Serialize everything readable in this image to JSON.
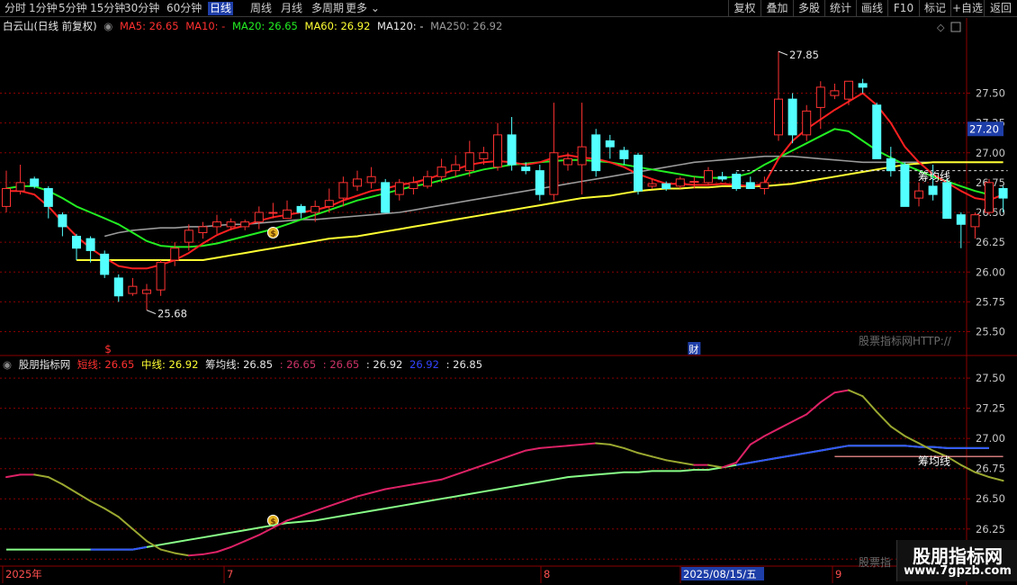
{
  "toolbar": {
    "periods": [
      "分时",
      "1分钟",
      "5分钟",
      "15分钟",
      "30分钟",
      "60分钟",
      "日线",
      "周线",
      "月线",
      "多周期",
      "更多"
    ],
    "active_period": "日线",
    "buttons": [
      "复权",
      "叠加",
      "多股",
      "统计",
      "画线",
      "F10",
      "标记",
      "+自选",
      "返回"
    ]
  },
  "main_legend": {
    "title": "白云山(日线 前复权)",
    "ma5": "MA5: 26.65",
    "ma10": "MA10: -",
    "ma20": "MA20: 26.65",
    "ma60": "MA60: 26.92",
    "ma120": "MA120: -",
    "ma250": "MA250: 26.92"
  },
  "sub_legend": {
    "title": "股朋指标网",
    "short": "短线: 26.65",
    "mid": "中线: 26.92",
    "chip": "筹均线: 26.85",
    "v1": ": 26.65",
    "v2": ": 26.65",
    "v3": ": 26.92",
    "v4": "26.92",
    "v5": ": 26.85"
  },
  "colors": {
    "up": "#ff3232",
    "down": "#54ffff",
    "ma5": "#ff2020",
    "ma20": "#22ee22",
    "ma60": "#ffff33",
    "ma250": "#9a9a9a",
    "grid": "#8b0000",
    "axis_label": "#c8c8c8"
  },
  "chart_data": [
    {
      "type": "candlestick",
      "title": "白云山(日线 前复权)",
      "ylim": [
        25.3,
        28.1
      ],
      "y_ticks": [
        25.5,
        25.75,
        26.0,
        26.25,
        26.5,
        26.75,
        27.0,
        27.25,
        27.5
      ],
      "current_price": "27.20",
      "annotations": {
        "high": "27.85",
        "low": "25.68",
        "chip_label": "筹均线",
        "marker_left": "$",
        "marker_right": "财"
      },
      "candles": [
        {
          "o": 26.55,
          "c": 26.7,
          "h": 26.85,
          "l": 26.5
        },
        {
          "o": 26.68,
          "c": 26.75,
          "h": 26.9,
          "l": 26.65
        },
        {
          "o": 26.78,
          "c": 26.72,
          "h": 26.8,
          "l": 26.7
        },
        {
          "o": 26.7,
          "c": 26.55,
          "h": 26.72,
          "l": 26.45
        },
        {
          "o": 26.48,
          "c": 26.38,
          "h": 26.5,
          "l": 26.3
        },
        {
          "o": 26.3,
          "c": 26.2,
          "h": 26.32,
          "l": 26.1
        },
        {
          "o": 26.28,
          "c": 26.18,
          "h": 26.3,
          "l": 26.08
        },
        {
          "o": 26.15,
          "c": 25.98,
          "h": 26.18,
          "l": 25.95
        },
        {
          "o": 25.95,
          "c": 25.8,
          "h": 25.98,
          "l": 25.75
        },
        {
          "o": 25.82,
          "c": 25.88,
          "h": 25.95,
          "l": 25.8
        },
        {
          "o": 25.82,
          "c": 25.85,
          "h": 25.9,
          "l": 25.68
        },
        {
          "o": 25.85,
          "c": 26.08,
          "h": 26.1,
          "l": 25.8
        },
        {
          "o": 26.1,
          "c": 26.2,
          "h": 26.25,
          "l": 26.05
        },
        {
          "o": 26.25,
          "c": 26.35,
          "h": 26.4,
          "l": 26.18
        },
        {
          "o": 26.33,
          "c": 26.38,
          "h": 26.42,
          "l": 26.28
        },
        {
          "o": 26.38,
          "c": 26.42,
          "h": 26.48,
          "l": 26.32
        },
        {
          "o": 26.38,
          "c": 26.42,
          "h": 26.45,
          "l": 26.35
        },
        {
          "o": 26.38,
          "c": 26.42,
          "h": 26.44,
          "l": 26.35
        },
        {
          "o": 26.42,
          "c": 26.5,
          "h": 26.55,
          "l": 26.36
        },
        {
          "o": 26.5,
          "c": 26.5,
          "h": 26.58,
          "l": 26.45
        },
        {
          "o": 26.45,
          "c": 26.52,
          "h": 26.6,
          "l": 26.45
        },
        {
          "o": 26.55,
          "c": 26.5,
          "h": 26.57,
          "l": 26.45
        },
        {
          "o": 26.5,
          "c": 26.55,
          "h": 26.6,
          "l": 26.42
        },
        {
          "o": 26.55,
          "c": 26.6,
          "h": 26.7,
          "l": 26.5
        },
        {
          "o": 26.62,
          "c": 26.75,
          "h": 26.8,
          "l": 26.55
        },
        {
          "o": 26.72,
          "c": 26.78,
          "h": 26.85,
          "l": 26.68
        },
        {
          "o": 26.75,
          "c": 26.8,
          "h": 26.88,
          "l": 26.7
        },
        {
          "o": 26.75,
          "c": 26.5,
          "h": 26.78,
          "l": 26.5
        },
        {
          "o": 26.65,
          "c": 26.75,
          "h": 26.78,
          "l": 26.6
        },
        {
          "o": 26.7,
          "c": 26.75,
          "h": 26.8,
          "l": 26.65
        },
        {
          "o": 26.72,
          "c": 26.8,
          "h": 26.85,
          "l": 26.7
        },
        {
          "o": 26.8,
          "c": 26.88,
          "h": 26.95,
          "l": 26.75
        },
        {
          "o": 26.85,
          "c": 26.9,
          "h": 26.98,
          "l": 26.8
        },
        {
          "o": 26.85,
          "c": 27.0,
          "h": 27.1,
          "l": 26.8
        },
        {
          "o": 26.95,
          "c": 27.0,
          "h": 27.05,
          "l": 26.9
        },
        {
          "o": 26.88,
          "c": 27.15,
          "h": 27.25,
          "l": 26.85
        },
        {
          "o": 27.15,
          "c": 26.9,
          "h": 27.3,
          "l": 26.85
        },
        {
          "o": 26.88,
          "c": 26.85,
          "h": 26.92,
          "l": 26.82
        },
        {
          "o": 26.85,
          "c": 26.65,
          "h": 26.9,
          "l": 26.6
        },
        {
          "o": 26.65,
          "c": 27.0,
          "h": 27.42,
          "l": 26.6
        },
        {
          "o": 26.9,
          "c": 26.95,
          "h": 27.0,
          "l": 26.85
        },
        {
          "o": 26.9,
          "c": 27.05,
          "h": 27.42,
          "l": 26.65
        },
        {
          "o": 27.15,
          "c": 26.85,
          "h": 27.2,
          "l": 26.8
        },
        {
          "o": 27.1,
          "c": 27.05,
          "h": 27.15,
          "l": 26.95
        },
        {
          "o": 27.02,
          "c": 26.95,
          "h": 27.05,
          "l": 26.9
        },
        {
          "o": 26.98,
          "c": 26.68,
          "h": 27.0,
          "l": 26.65
        },
        {
          "o": 26.72,
          "c": 26.74,
          "h": 26.78,
          "l": 26.7
        },
        {
          "o": 26.74,
          "c": 26.7,
          "h": 26.76,
          "l": 26.68
        },
        {
          "o": 26.72,
          "c": 26.78,
          "h": 26.8,
          "l": 26.7
        },
        {
          "o": 26.76,
          "c": 26.76,
          "h": 26.8,
          "l": 26.7
        },
        {
          "o": 26.75,
          "c": 26.85,
          "h": 26.88,
          "l": 26.73
        },
        {
          "o": 26.8,
          "c": 26.78,
          "h": 26.84,
          "l": 26.76
        },
        {
          "o": 26.82,
          "c": 26.7,
          "h": 26.84,
          "l": 26.68
        },
        {
          "o": 26.75,
          "c": 26.7,
          "h": 26.8,
          "l": 26.7
        },
        {
          "o": 26.7,
          "c": 26.75,
          "h": 26.8,
          "l": 26.65
        },
        {
          "o": 27.15,
          "c": 27.45,
          "h": 27.85,
          "l": 27.1
        },
        {
          "o": 27.45,
          "c": 27.15,
          "h": 27.5,
          "l": 27.08
        },
        {
          "o": 27.15,
          "c": 27.35,
          "h": 27.4,
          "l": 27.1
        },
        {
          "o": 27.38,
          "c": 27.55,
          "h": 27.6,
          "l": 27.2
        },
        {
          "o": 27.48,
          "c": 27.52,
          "h": 27.58,
          "l": 27.45
        },
        {
          "o": 27.45,
          "c": 27.6,
          "h": 27.6,
          "l": 27.4
        },
        {
          "o": 27.58,
          "c": 27.55,
          "h": 27.62,
          "l": 27.5
        },
        {
          "o": 27.4,
          "c": 26.95,
          "h": 27.42,
          "l": 26.95
        },
        {
          "o": 26.95,
          "c": 26.85,
          "h": 27.05,
          "l": 26.8
        },
        {
          "o": 26.9,
          "c": 26.55,
          "h": 26.92,
          "l": 26.55
        },
        {
          "o": 26.62,
          "c": 26.68,
          "h": 26.75,
          "l": 26.55
        },
        {
          "o": 26.72,
          "c": 26.65,
          "h": 26.9,
          "l": 26.6
        },
        {
          "o": 26.75,
          "c": 26.45,
          "h": 26.78,
          "l": 26.45
        },
        {
          "o": 26.48,
          "c": 26.4,
          "h": 26.5,
          "l": 26.2
        },
        {
          "o": 26.38,
          "c": 26.48,
          "h": 26.5,
          "l": 26.28
        },
        {
          "o": 26.5,
          "c": 26.75,
          "h": 26.78,
          "l": 26.48
        },
        {
          "o": 26.7,
          "c": 26.62,
          "h": 26.72,
          "l": 26.5
        }
      ],
      "ma5": [
        26.68,
        26.68,
        26.65,
        26.55,
        26.42,
        26.3,
        26.2,
        26.12,
        26.05,
        26.03,
        26.03,
        26.06,
        26.1,
        26.16,
        26.24,
        26.31,
        26.36,
        26.39,
        26.43,
        26.46,
        26.48,
        26.5,
        26.52,
        26.55,
        26.6,
        26.64,
        26.68,
        26.7,
        26.73,
        26.75,
        26.78,
        26.82,
        26.86,
        26.9,
        26.92,
        26.93,
        26.92,
        26.9,
        26.92,
        26.96,
        26.98,
        26.96,
        26.95,
        26.92,
        26.88,
        26.82,
        26.78,
        26.74,
        26.74,
        26.73,
        26.73,
        26.74,
        26.73,
        26.72,
        26.74,
        26.95,
        27.1,
        27.2,
        27.28,
        27.36,
        27.43,
        27.5,
        27.4,
        27.25,
        27.05,
        26.92,
        26.82,
        26.75,
        26.68,
        26.62,
        26.6,
        26.65
      ],
      "ma20": [
        26.7,
        26.72,
        26.72,
        26.68,
        26.62,
        26.55,
        26.5,
        26.45,
        26.4,
        26.33,
        26.26,
        26.22,
        26.21,
        26.21,
        26.22,
        26.24,
        26.27,
        26.3,
        26.33,
        26.36,
        26.4,
        26.44,
        26.48,
        26.52,
        26.56,
        26.6,
        26.63,
        26.66,
        26.69,
        26.72,
        26.74,
        26.77,
        26.8,
        26.83,
        26.86,
        26.88,
        26.9,
        26.91,
        26.92,
        26.93,
        26.94,
        26.94,
        26.93,
        26.92,
        26.9,
        26.88,
        26.86,
        26.84,
        26.82,
        26.8,
        26.79,
        26.79,
        26.8,
        26.83,
        26.9,
        26.96,
        27.02,
        27.08,
        27.14,
        27.2,
        27.18,
        27.1,
        27.02,
        26.96,
        26.9,
        26.85,
        26.8,
        26.76,
        26.72,
        26.68,
        26.65
      ],
      "ma60": [
        26.1,
        26.1,
        26.1,
        26.1,
        26.1,
        26.1,
        26.1,
        26.1,
        26.1,
        26.1,
        26.12,
        26.14,
        26.16,
        26.18,
        26.2,
        26.22,
        26.24,
        26.26,
        26.28,
        26.29,
        26.3,
        26.32,
        26.34,
        26.36,
        26.38,
        26.4,
        26.42,
        26.44,
        26.46,
        26.48,
        26.5,
        26.52,
        26.54,
        26.56,
        26.58,
        26.6,
        26.62,
        26.63,
        26.64,
        26.66,
        26.68,
        26.69,
        26.7,
        26.7,
        26.71,
        26.71,
        26.72,
        26.72,
        26.72,
        26.72,
        26.73,
        26.74,
        26.76,
        26.78,
        26.8,
        26.82,
        26.84,
        26.86,
        26.88,
        26.9,
        26.91,
        26.92,
        26.92,
        26.92,
        26.92,
        26.92,
        26.92
      ],
      "ma250": [
        26.3,
        26.33,
        26.35,
        26.36,
        26.37,
        26.37,
        26.38,
        26.38,
        26.39,
        26.4,
        26.4,
        26.41,
        26.42,
        26.43,
        26.44,
        26.44,
        26.45,
        26.46,
        26.47,
        26.48,
        26.49,
        26.5,
        26.52,
        26.54,
        26.56,
        26.58,
        26.6,
        26.62,
        26.64,
        26.66,
        26.68,
        26.7,
        26.72,
        26.74,
        26.76,
        26.78,
        26.8,
        26.82,
        26.84,
        26.86,
        26.88,
        26.9,
        26.92,
        26.93,
        26.94,
        26.95,
        26.96,
        26.97,
        26.97,
        26.97,
        26.96,
        26.95,
        26.94,
        26.93,
        26.92,
        26.92,
        26.92,
        26.92,
        26.92,
        26.92,
        26.92,
        26.92,
        26.92,
        26.92,
        26.92
      ],
      "chip_avg": 26.85
    },
    {
      "type": "line",
      "title": "股朋指标网",
      "ylim": [
        25.95,
        27.65
      ],
      "y_ticks": [
        26.0,
        26.25,
        26.5,
        26.75,
        27.0,
        27.25,
        27.5
      ],
      "chip_label": "筹均线",
      "x_labels": [
        "2025年",
        "7",
        "8",
        "2025/08/15/五",
        "9"
      ],
      "series": [
        {
          "name": "短线",
          "values": [
            26.68,
            26.7,
            26.7,
            26.68,
            26.62,
            26.55,
            26.48,
            26.42,
            26.35,
            26.25,
            26.15,
            26.08,
            26.05,
            26.03,
            26.04,
            26.06,
            26.1,
            26.15,
            26.2,
            26.26,
            26.32,
            26.36,
            26.4,
            26.44,
            26.48,
            26.52,
            26.55,
            26.58,
            26.6,
            26.62,
            26.64,
            26.66,
            26.7,
            26.74,
            26.78,
            26.82,
            26.86,
            26.9,
            26.92,
            26.93,
            26.94,
            26.95,
            26.96,
            26.95,
            26.92,
            26.88,
            26.85,
            26.82,
            26.8,
            26.78,
            26.78,
            26.76,
            26.8,
            26.95,
            27.02,
            27.08,
            27.14,
            27.2,
            27.3,
            27.38,
            27.4,
            27.35,
            27.22,
            27.1,
            27.02,
            26.96,
            26.9,
            26.85,
            26.78,
            26.72,
            26.68,
            26.65
          ]
        },
        {
          "name": "中线",
          "values": [
            26.08,
            26.08,
            26.08,
            26.08,
            26.08,
            26.08,
            26.08,
            26.08,
            26.08,
            26.08,
            26.1,
            26.12,
            26.14,
            26.16,
            26.18,
            26.2,
            26.22,
            26.24,
            26.26,
            26.28,
            26.3,
            26.31,
            26.32,
            26.34,
            26.36,
            26.38,
            26.4,
            26.42,
            26.44,
            26.46,
            26.48,
            26.5,
            26.52,
            26.54,
            26.56,
            26.58,
            26.6,
            26.62,
            26.64,
            26.66,
            26.68,
            26.69,
            26.7,
            26.71,
            26.72,
            26.72,
            26.73,
            26.73,
            26.73,
            26.74,
            26.74,
            26.76,
            26.78,
            26.8,
            26.82,
            26.84,
            26.86,
            26.88,
            26.9,
            26.92,
            26.94,
            26.94,
            26.94,
            26.94,
            26.94,
            26.93,
            26.93,
            26.92,
            26.92,
            26.92,
            26.92
          ]
        },
        {
          "name": "筹均线",
          "values": [
            26.85,
            26.85,
            26.85,
            26.85,
            26.85,
            26.85,
            26.85,
            26.85,
            26.85,
            26.85,
            26.85,
            26.85,
            26.85
          ]
        }
      ]
    }
  ]
}
